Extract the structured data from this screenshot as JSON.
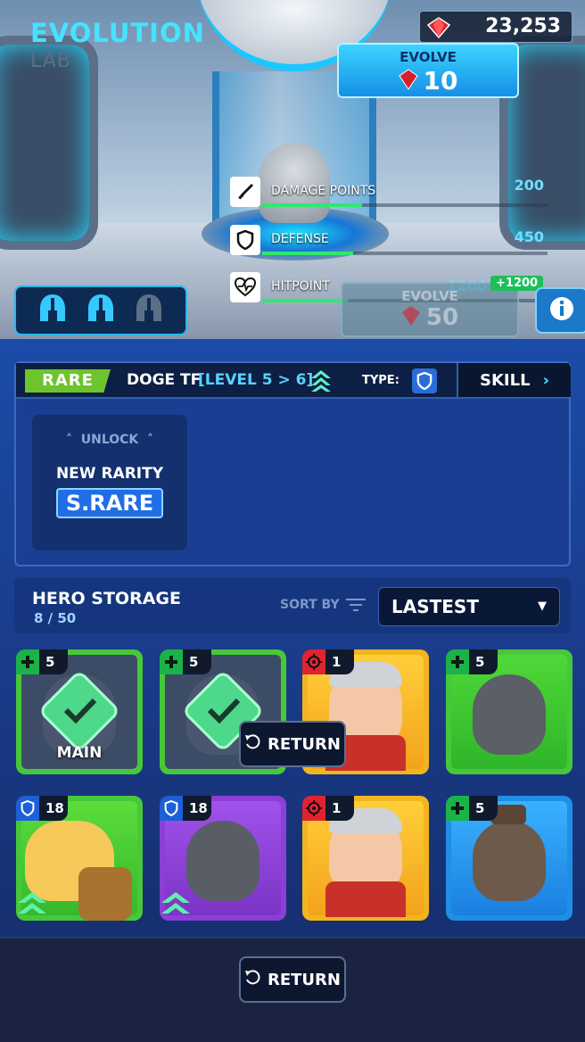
{
  "header": {
    "title": "EVOLUTION",
    "subtitle": "LAB"
  },
  "currency": {
    "gems": "23,253"
  },
  "evolve_primary": {
    "label": "EVOLVE",
    "cost": "10"
  },
  "evolve_secondary": {
    "label": "EVOLVE",
    "cost": "50"
  },
  "stats": [
    {
      "name": "DAMAGE POINTS",
      "value": "200",
      "icon": "sword-icon",
      "fill": 0.35
    },
    {
      "name": "DEFENSE",
      "value": "450",
      "icon": "shield-icon",
      "fill": 0.32
    },
    {
      "name": "HITPOINT",
      "value": "1200",
      "bonus": "+1200",
      "icon": "heart-pulse-icon",
      "fill": 0.3
    }
  ],
  "evolution_stages": {
    "total": 3,
    "completed": 2
  },
  "hero": {
    "rarity": "RARE",
    "name": "DOGE TF",
    "level": "[LEVEL 5 > 6]",
    "type_label": "TYPE:",
    "skill_label": "SKILL"
  },
  "unlock": {
    "title": "UNLOCK",
    "subtitle": "NEW RARITY",
    "rarity": "S.RARE"
  },
  "storage": {
    "title": "HERO STORAGE",
    "count": "8 / 50",
    "sort_label": "SORT BY",
    "sort_value": "LASTEST"
  },
  "heroes": [
    {
      "level": "5",
      "type": "heal",
      "frame": "green",
      "selected": true,
      "label": "MAIN"
    },
    {
      "level": "5",
      "type": "heal",
      "frame": "green",
      "selected": true,
      "label": ""
    },
    {
      "level": "1",
      "type": "target",
      "frame": "yellow",
      "selected": false,
      "label": ""
    },
    {
      "level": "5",
      "type": "heal",
      "frame": "green",
      "selected": false,
      "label": ""
    },
    {
      "level": "18",
      "type": "shield",
      "frame": "green",
      "selected": false,
      "label": ""
    },
    {
      "level": "18",
      "type": "shield",
      "frame": "purple",
      "selected": false,
      "label": ""
    },
    {
      "level": "1",
      "type": "target",
      "frame": "yellow",
      "selected": false,
      "label": ""
    },
    {
      "level": "5",
      "type": "heal",
      "frame": "blue",
      "selected": false,
      "label": ""
    }
  ],
  "buttons": {
    "return_overlay": "RETURN",
    "return_footer": "RETURN"
  },
  "colors": {
    "accent": "#45e3ff",
    "rare": "#6dc42c",
    "frame_green": "#47c83a",
    "frame_yellow": "#f2b51f",
    "frame_purple": "#8a3fd6",
    "frame_blue": "#1f8fe6"
  }
}
